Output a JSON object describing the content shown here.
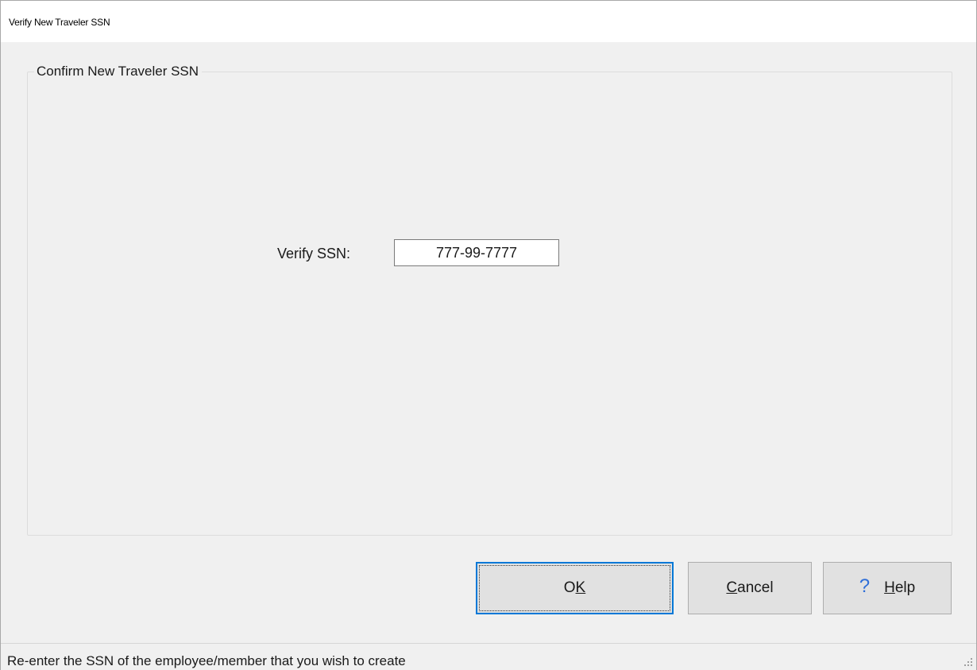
{
  "window": {
    "title": "Verify New Traveler SSN"
  },
  "group": {
    "legend": "Confirm New Traveler SSN"
  },
  "form": {
    "ssn_label": "Verify SSN:",
    "ssn_value": "777-99-7777"
  },
  "buttons": {
    "ok": {
      "pre": "O",
      "accel": "K",
      "post": ""
    },
    "cancel": {
      "pre": "",
      "accel": "C",
      "post": "ancel"
    },
    "help": {
      "pre": "",
      "accel": "H",
      "post": "elp",
      "icon": "?"
    }
  },
  "status": {
    "text": "Re-enter the SSN of the employee/member that you wish to create"
  },
  "colors": {
    "accent": "#0078d7",
    "help_icon": "#2f6fd8",
    "background": "#f0f0f0"
  }
}
